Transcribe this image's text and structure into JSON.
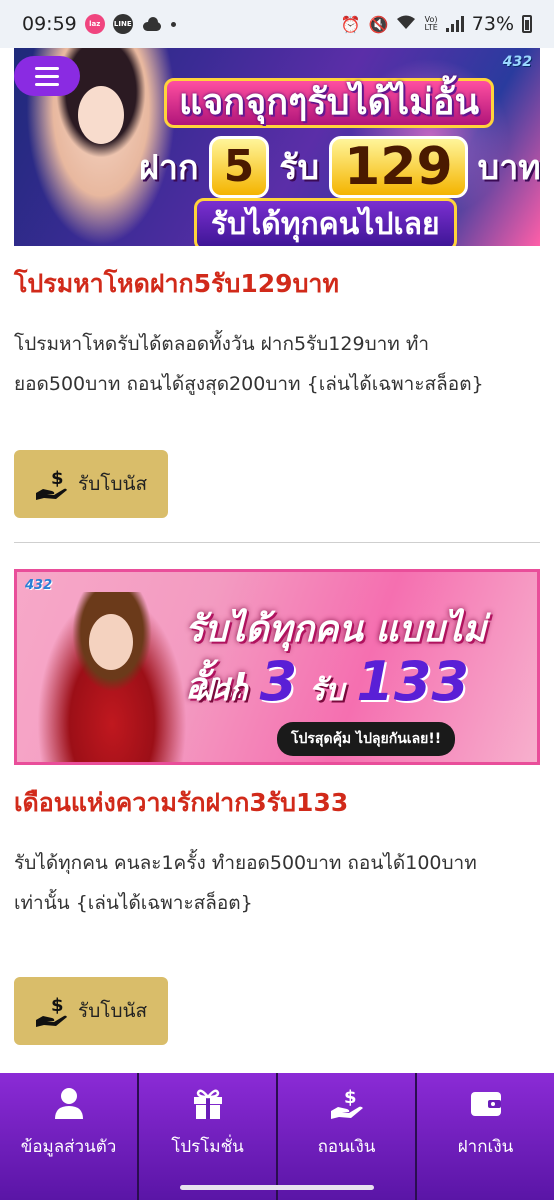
{
  "status_bar": {
    "time": "09:59",
    "app_lazada": "laz",
    "app_line": "LINE",
    "network_volte": "Vo)",
    "network_lte": "LTE",
    "battery": "73%"
  },
  "header": {
    "menu_label": "menu"
  },
  "promos": [
    {
      "banner": {
        "headline": "แจกจุกๆรับได้ไม่อั้น",
        "deposit_word": "ฝาก",
        "deposit_amount": "5",
        "receive_word": "รับ",
        "receive_amount": "129",
        "currency": "บาท",
        "subline": "รับได้ทุกคนไปเลย",
        "logo": "432"
      },
      "title": "โปรมหาโหดฝาก5รับ129บาท",
      "description": "โปรมหาโหดรับได้ตลอดทั้งวัน ฝาก5รับ129บาท ทำยอด500บาท ถอนได้สูงสุด200บาท {เล่นได้เฉพาะสล็อต}",
      "button_label": "รับโบนัส"
    },
    {
      "banner": {
        "logo": "432",
        "headline": "รับได้ทุกคน แบบไม่อั้น!",
        "deposit_word": "ฝาก",
        "deposit_amount": "3",
        "receive_word": "รับ",
        "receive_amount": "133",
        "pill": "โปรสุดคุ้ม ไปลุยกันเลย!!"
      },
      "title": "เดือนแห่งความรักฝาก3รับ133",
      "description": "รับได้ทุกคน คนละ1ครั้ง ทำยอด500บาท ถอนได้100บาท เท่านั้น {เล่นได้เฉพาะสล็อต}",
      "button_label": "รับโบนัส"
    }
  ],
  "bottom_nav": [
    {
      "label": "ข้อมูลส่วนตัว",
      "icon": "user-icon"
    },
    {
      "label": "โปรโมชั่น",
      "icon": "gift-icon"
    },
    {
      "label": "ถอนเงิน",
      "icon": "hand-money-icon"
    },
    {
      "label": "ฝากเงิน",
      "icon": "wallet-icon"
    }
  ],
  "colors": {
    "accent_purple": "#8a2be2",
    "title_red": "#d12a1a",
    "button_gold": "#d9bd6a"
  }
}
